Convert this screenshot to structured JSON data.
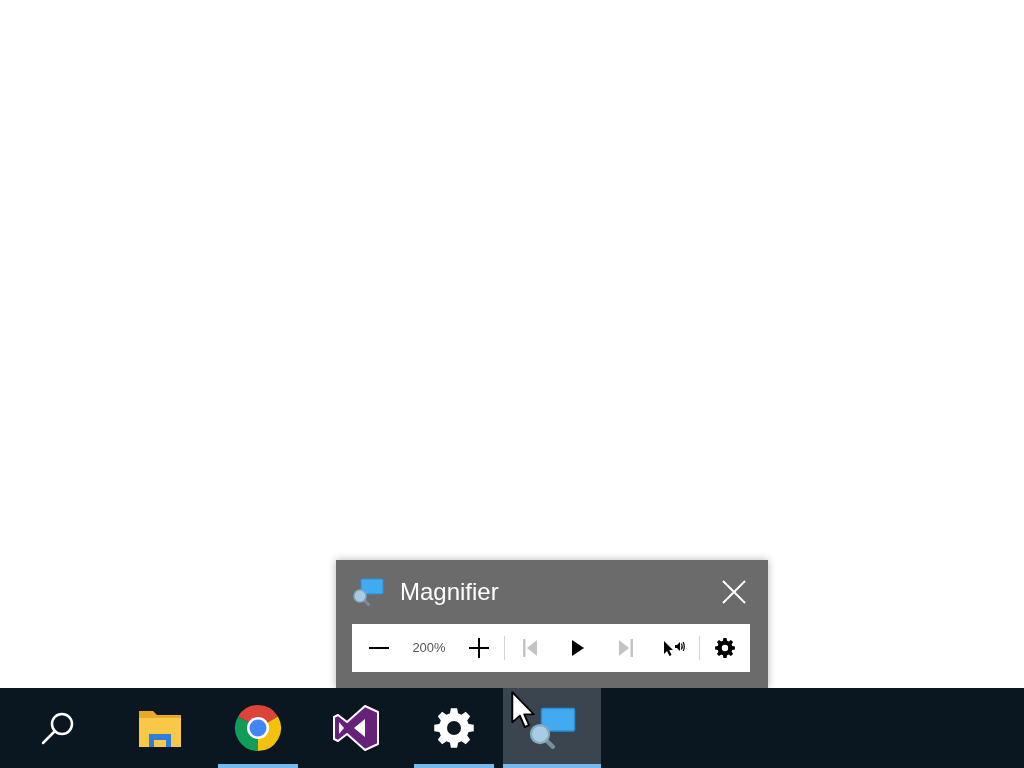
{
  "window": {
    "title": "Magnifier",
    "toolbar": [
      {
        "kind": "minus",
        "disabled": false
      },
      {
        "kind": "level",
        "text": "200%"
      },
      {
        "kind": "plus",
        "disabled": false
      },
      {
        "kind": "separator"
      },
      {
        "kind": "previous",
        "disabled": true
      },
      {
        "kind": "play",
        "disabled": false
      },
      {
        "kind": "next",
        "disabled": true
      },
      {
        "kind": "reader",
        "disabled": false
      },
      {
        "kind": "separator"
      },
      {
        "kind": "settings",
        "disabled": false
      }
    ]
  },
  "taskbar": {
    "items": [
      {
        "kind": "search",
        "running": false,
        "active": false
      },
      {
        "kind": "folder",
        "running": false,
        "active": false
      },
      {
        "kind": "browser",
        "running": true,
        "active": false
      },
      {
        "kind": "studio",
        "running": false,
        "active": false
      },
      {
        "kind": "settings",
        "running": true,
        "active": false
      },
      {
        "kind": "magnifier",
        "running": true,
        "active": true
      }
    ]
  }
}
